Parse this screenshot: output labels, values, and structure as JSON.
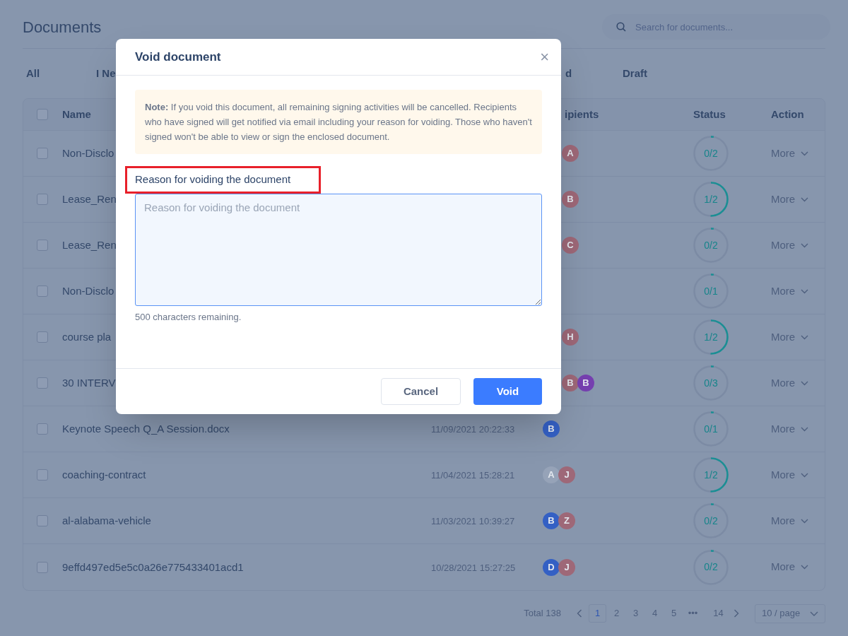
{
  "page": {
    "title": "Documents",
    "search": {
      "placeholder": "Search for documents..."
    }
  },
  "tabs": [
    {
      "label": "All"
    },
    {
      "label": "I Ne"
    },
    {
      "label": "d"
    },
    {
      "label": "Draft"
    }
  ],
  "table": {
    "select_all_checked": false,
    "columns": [
      "Name",
      "ipients",
      "Status",
      "Action"
    ],
    "rows": [
      {
        "checked": false,
        "name": "Non-Disclo",
        "recipients": [
          {
            "initial": "A",
            "color": "#9e6878"
          }
        ],
        "status": "0/2",
        "level": 0,
        "action": "More"
      },
      {
        "checked": false,
        "name": "Lease_Ren",
        "recipients": [
          {
            "initial": "B",
            "color": "#9e6878"
          }
        ],
        "status": "1/2",
        "level": 0.5,
        "action": "More"
      },
      {
        "checked": false,
        "name": "Lease_Ren",
        "recipients": [
          {
            "initial": "C",
            "color": "#9e6878"
          }
        ],
        "status": "0/2",
        "level": 0,
        "action": "More"
      },
      {
        "checked": false,
        "name": "Non-Disclo",
        "recipients": [],
        "status": "0/1",
        "level": 0,
        "action": "More"
      },
      {
        "checked": false,
        "name": "course pla",
        "recipients": [
          {
            "initial": "H",
            "color": "#9e6878"
          }
        ],
        "status": "1/2",
        "level": 0.5,
        "action": "More"
      },
      {
        "checked": false,
        "name": "30 INTERV",
        "recipients": [
          {
            "initial": "B",
            "color": "#9e6878"
          },
          {
            "initial": "B",
            "color": "#7640b0"
          }
        ],
        "status": "0/3",
        "level": 0,
        "action": "More"
      },
      {
        "checked": false,
        "name": "Keynote Speech Q_A Session.docx",
        "date": "11/09/2021 20:22:33",
        "recipients": [
          {
            "initial": "B",
            "color": "#3460c4"
          }
        ],
        "status": "0/1",
        "level": 0,
        "action": "More"
      },
      {
        "checked": false,
        "name": "coaching-contract",
        "date": "11/04/2021 15:28:21",
        "recipients": [
          {
            "initial": "A",
            "color": "#96a3b8"
          },
          {
            "initial": "J",
            "color": "#9e6878"
          }
        ],
        "status": "1/2",
        "level": 0.5,
        "action": "More"
      },
      {
        "checked": false,
        "name": "al-alabama-vehicle",
        "date": "11/03/2021 10:39:27",
        "recipients": [
          {
            "initial": "B",
            "color": "#3460c4"
          },
          {
            "initial": "Z",
            "color": "#9e6878"
          }
        ],
        "status": "0/2",
        "level": 0,
        "action": "More"
      },
      {
        "checked": false,
        "name": "9effd497ed5e5c0a26e775433401acd1",
        "date": "10/28/2021 15:27:25",
        "recipients": [
          {
            "initial": "D",
            "color": "#3460c4"
          },
          {
            "initial": "J",
            "color": "#9e6878"
          }
        ],
        "status": "0/2",
        "level": 0,
        "action": "More"
      }
    ]
  },
  "pagination": {
    "total": "Total 138",
    "pages": [
      {
        "label": "1",
        "selected": true
      },
      {
        "label": "2",
        "selected": false
      },
      {
        "label": "3",
        "selected": false
      },
      {
        "label": "4",
        "selected": false
      },
      {
        "label": "5",
        "selected": false
      },
      {
        "label": "•••",
        "selected": false
      },
      {
        "label": "14",
        "selected": false
      }
    ],
    "page_size": "10 / page"
  },
  "dialog": {
    "title": "Void document",
    "close": "×",
    "note": "**Note:** If you void this document, all remaining signing activities will be cancelled. Recipients who have signed will get notified via email including your reason for voiding. Those who haven't signed won't be able to view or sign the enclosed document.",
    "field_label": "Reason for voiding the document",
    "placeholder": "Reason for voiding the document",
    "counter": "500 characters remaining.",
    "buttons": [
      {
        "label": "Cancel",
        "kind": "secondary"
      },
      {
        "label": "Void",
        "kind": "primary"
      }
    ]
  }
}
